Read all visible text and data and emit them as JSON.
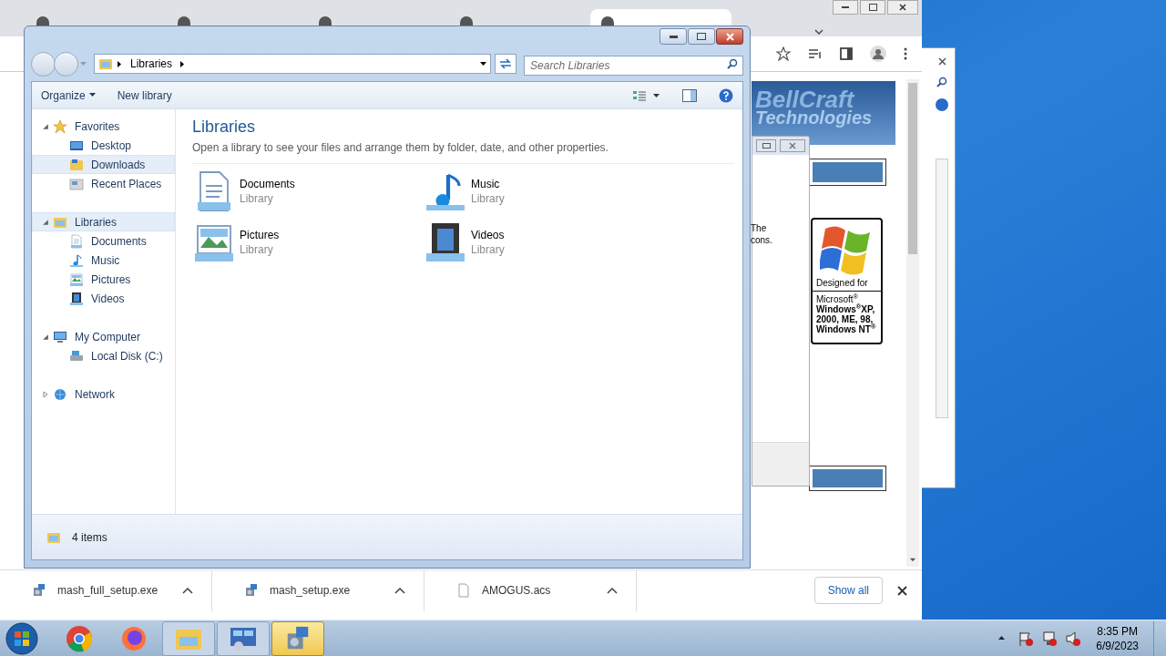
{
  "browser": {
    "tabs": [
      {
        "selected": false
      },
      {
        "selected": false
      },
      {
        "selected": false
      },
      {
        "selected": false
      },
      {
        "selected": true
      }
    ],
    "page": {
      "logo_line1": "BellCraft",
      "logo_line2": "Technologies",
      "dialog_lines": [
        "The",
        "cons."
      ],
      "badge": {
        "caption": "Designed for",
        "lines": [
          "Microsoft$^{®}$",
          "Windows$^{®}$XP,",
          "2000, ME, 98,",
          "Windows NT$^{®}$"
        ]
      }
    },
    "downloads": [
      {
        "name": "mash_full_setup.exe",
        "kind": "installer"
      },
      {
        "name": "mash_setup.exe",
        "kind": "installer"
      },
      {
        "name": "AMOGUS.acs",
        "kind": "file"
      }
    ],
    "show_all": "Show all"
  },
  "explorer": {
    "address": [
      "Libraries"
    ],
    "search": {
      "placeholder": "Search Libraries"
    },
    "toolbar": [
      {
        "label": "Organize",
        "menu": true
      },
      {
        "label": "New library",
        "menu": false
      }
    ],
    "nav": [
      {
        "label": "Favorites",
        "kind": "star",
        "expanded": true,
        "highlighted": false,
        "children": [
          {
            "label": "Desktop",
            "kind": "desktop",
            "highlighted": false
          },
          {
            "label": "Downloads",
            "kind": "downloads",
            "highlighted": true
          },
          {
            "label": "Recent Places",
            "kind": "recent",
            "highlighted": false
          }
        ]
      },
      {
        "label": "Libraries",
        "kind": "library",
        "expanded": true,
        "highlighted": true,
        "children": [
          {
            "label": "Documents",
            "kind": "documents",
            "highlighted": false
          },
          {
            "label": "Music",
            "kind": "music",
            "highlighted": false
          },
          {
            "label": "Pictures",
            "kind": "pictures",
            "highlighted": false
          },
          {
            "label": "Videos",
            "kind": "videos",
            "highlighted": false
          }
        ]
      },
      {
        "label": "My Computer",
        "kind": "computer",
        "expanded": true,
        "highlighted": false,
        "children": [
          {
            "label": "Local Disk (C:)",
            "kind": "disk",
            "highlighted": false
          }
        ]
      },
      {
        "label": "Network",
        "kind": "network",
        "expanded": false,
        "highlighted": false
      }
    ],
    "heading": "Libraries",
    "subtitle": "Open a library to see your files and arrange them by folder, date, and other properties.",
    "items": [
      {
        "name": "Documents",
        "type": "Library",
        "kind": "documents"
      },
      {
        "name": "Music",
        "type": "Library",
        "kind": "music"
      },
      {
        "name": "Pictures",
        "type": "Library",
        "kind": "pictures"
      },
      {
        "name": "Videos",
        "type": "Library",
        "kind": "videos"
      }
    ],
    "status": "4 items"
  },
  "taskbar": {
    "apps": [
      {
        "kind": "chrome",
        "selected": false
      },
      {
        "kind": "firefox",
        "selected": false
      },
      {
        "kind": "explorer",
        "selected": false
      },
      {
        "kind": "control",
        "selected": false
      },
      {
        "kind": "installer",
        "selected": true
      }
    ],
    "time": "8:35 PM",
    "date": "6/9/2023"
  }
}
